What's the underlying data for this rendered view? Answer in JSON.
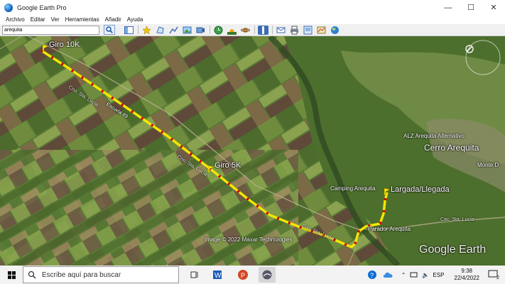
{
  "window": {
    "title": "Google Earth Pro",
    "buttons": {
      "minimize": "—",
      "maximize": "☐",
      "close": "✕"
    }
  },
  "menu": [
    "Archivo",
    "Editar",
    "Ver",
    "Herramientas",
    "Añadir",
    "Ayuda"
  ],
  "search": {
    "value": "arequita"
  },
  "map": {
    "labels": {
      "giro10k": "Giro 10K",
      "giro5k": "Giro 5K",
      "largada": "Largada/Llegada",
      "camping": "Camping Arequita",
      "parador": "Parador Arequita",
      "cerro": "Cerro Arequita",
      "alz": "ALZ Arequita Alternativo",
      "monte": "Monte D",
      "escuela": "Escuela 89",
      "image_credit": "Image © 2022 Maxar Technologies",
      "brand": "Google Earth",
      "road1": "Cno. Sta. Lucía",
      "road2": "Cno. Sta. Lucía",
      "road3": "Cac. Sta. Lucía"
    },
    "colors": {
      "route_yellow": "#f2e600",
      "route_red": "#d20000",
      "pin": "#ffe400"
    }
  },
  "taskbar": {
    "search_placeholder": "Escribe aquí para buscar",
    "language": "ESP",
    "time": "9:38",
    "date": "22/4/2022",
    "notifications": "2"
  }
}
